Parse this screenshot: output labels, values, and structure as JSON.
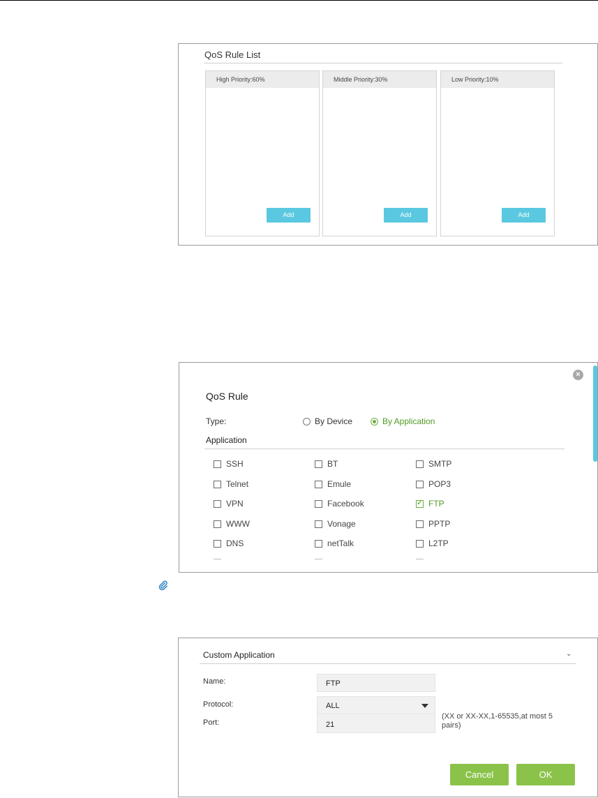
{
  "rule_list": {
    "title": "QoS Rule List",
    "columns": [
      {
        "label": "High Priority:60%",
        "add_label": "Add"
      },
      {
        "label": "Middle Priority:30%",
        "add_label": "Add"
      },
      {
        "label": "Low Priority:10%",
        "add_label": "Add"
      }
    ]
  },
  "qos_rule": {
    "title": "QoS Rule",
    "type_label": "Type:",
    "type_options": [
      {
        "label": "By Device",
        "selected": false
      },
      {
        "label": "By Application",
        "selected": true
      }
    ],
    "application_label": "Application",
    "applications": [
      {
        "label": "SSH",
        "checked": false
      },
      {
        "label": "BT",
        "checked": false
      },
      {
        "label": "SMTP",
        "checked": false
      },
      {
        "label": "Telnet",
        "checked": false
      },
      {
        "label": "Emule",
        "checked": false
      },
      {
        "label": "POP3",
        "checked": false
      },
      {
        "label": "VPN",
        "checked": false
      },
      {
        "label": "Facebook",
        "checked": false
      },
      {
        "label": "FTP",
        "checked": true
      },
      {
        "label": "WWW",
        "checked": false
      },
      {
        "label": "Vonage",
        "checked": false
      },
      {
        "label": "PPTP",
        "checked": false
      },
      {
        "label": "DNS",
        "checked": false
      },
      {
        "label": "netTalk",
        "checked": false
      },
      {
        "label": "L2TP",
        "checked": false
      }
    ]
  },
  "custom_app": {
    "title": "Custom Application",
    "name_label": "Name:",
    "name_value": "FTP",
    "protocol_label": "Protocol:",
    "protocol_value": "ALL",
    "port_label": "Port:",
    "port_value": "21",
    "port_hint": "(XX or XX-XX,1-65535,at most 5 pairs)",
    "cancel_label": "Cancel",
    "ok_label": "OK"
  },
  "colors": {
    "accent_blue": "#5ac8e0",
    "accent_green": "#8bc34a",
    "selected_green": "#4f9a22"
  }
}
